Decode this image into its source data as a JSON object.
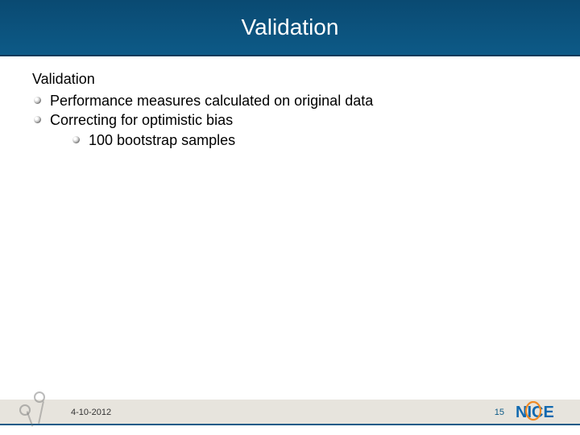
{
  "title": "Validation",
  "content": {
    "heading": "Validation",
    "items": [
      {
        "text": "Performance measures calculated on original data"
      },
      {
        "text": "Correcting for optimistic bias",
        "sub": [
          {
            "text": "100 bootstrap samples"
          }
        ]
      }
    ]
  },
  "footer": {
    "date": "4-10-2012",
    "page": "15",
    "logo_text": "NICE"
  }
}
